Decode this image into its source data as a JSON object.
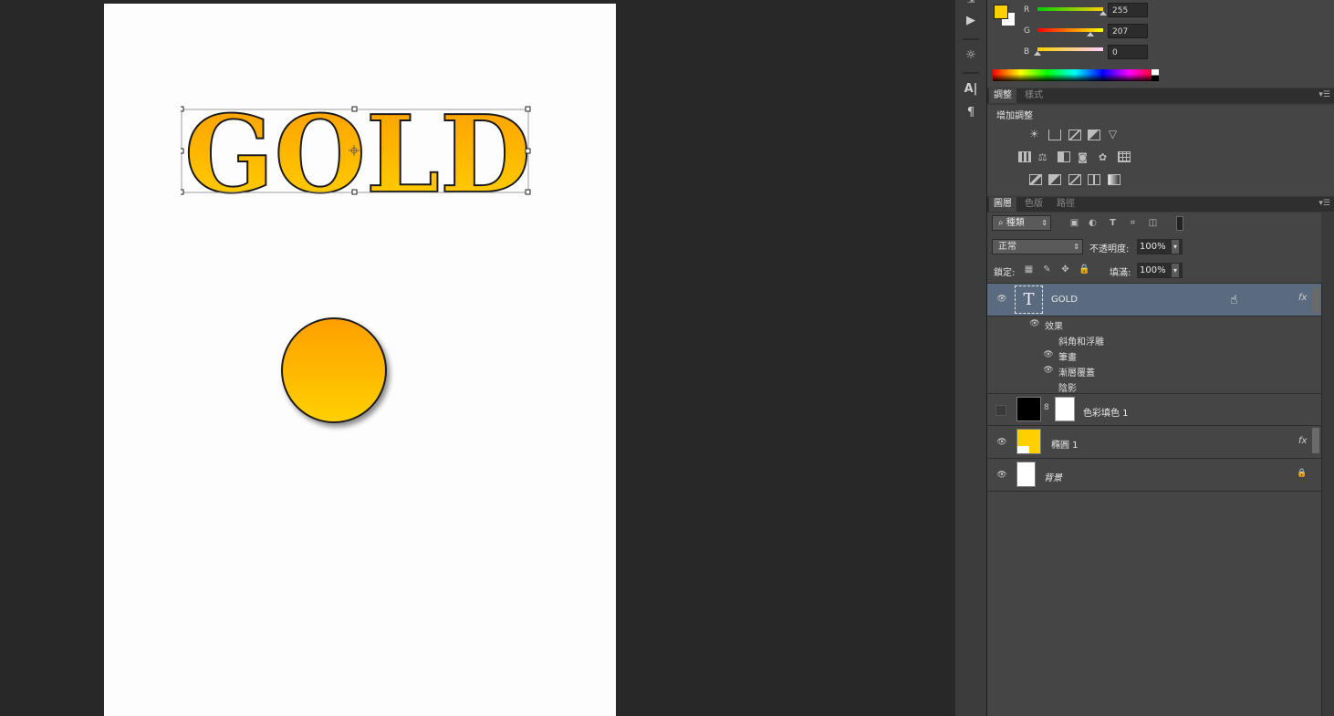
{
  "colors": {
    "foreground": "#ffcf00",
    "background": "#ffffff",
    "gold_top": "#ffa000",
    "gold_bottom": "#ffd200",
    "selected_layer": "#5a6b80"
  },
  "color_panel": {
    "channels": [
      {
        "label": "R",
        "value": "255",
        "level": 1.0
      },
      {
        "label": "G",
        "value": "207",
        "level": 0.81
      },
      {
        "label": "B",
        "value": "0",
        "level": 0.0
      }
    ]
  },
  "document": {
    "text_layer_content": "GOLD"
  },
  "adjust_panel": {
    "tabs": [
      "調整",
      "樣式"
    ],
    "title": "增加調整"
  },
  "layers_panel": {
    "tabs": [
      "圖層",
      "色版",
      "路徑"
    ],
    "filter_kind": "種類",
    "blend_mode": "正常",
    "opacity_label": "不透明度:",
    "opacity_value": "100%",
    "lock_label": "鎖定:",
    "fill_label": "填滿:",
    "fill_value": "100%",
    "layers": [
      {
        "name": "GOLD",
        "fx": "fx",
        "selected": true
      },
      {
        "name": "色彩填色 1"
      },
      {
        "name": "橢圓 1",
        "fx": "fx"
      },
      {
        "name": "背景"
      }
    ],
    "effects": {
      "header": "效果",
      "items": [
        "斜角和浮雕",
        "筆畫",
        "漸層覆蓋",
        "陰影"
      ]
    }
  },
  "icons": [
    "eye-icon",
    "lock-icon",
    "hand-cursor-icon",
    "text-layer-icon",
    "play-icon",
    "character-icon",
    "paragraph-icon",
    "light-bulb-icon"
  ]
}
